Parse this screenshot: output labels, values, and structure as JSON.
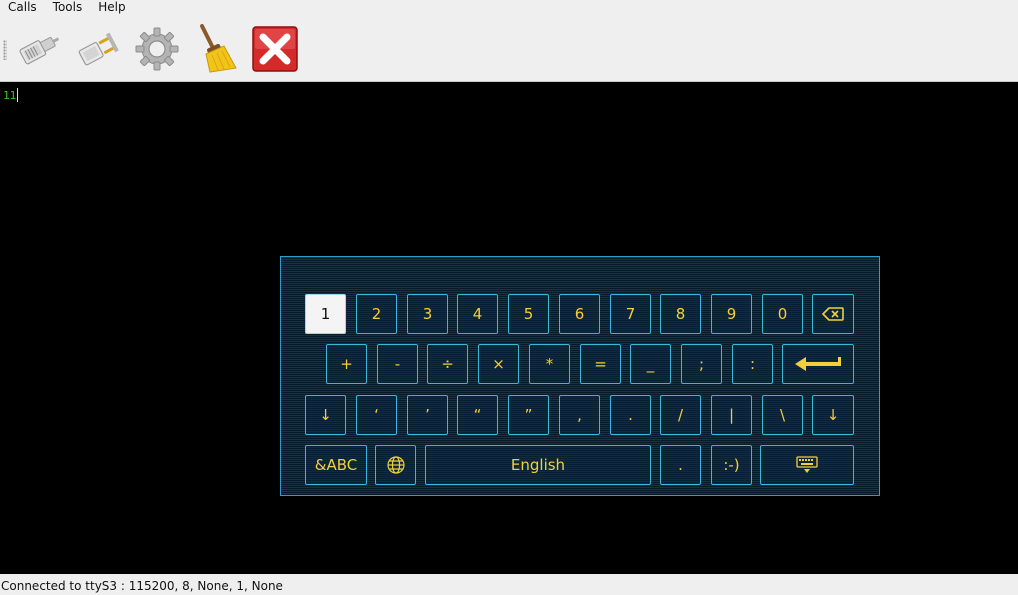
{
  "menubar": {
    "items": [
      "Calls",
      "Tools",
      "Help"
    ]
  },
  "toolbar": {
    "buttons": [
      "connect-icon",
      "disconnect-icon",
      "settings-gear-icon",
      "clear-broom-icon",
      "quit-close-icon"
    ]
  },
  "terminal": {
    "text": "11"
  },
  "keyboard": {
    "row1": [
      "1",
      "2",
      "3",
      "4",
      "5",
      "6",
      "7",
      "8",
      "9",
      "0"
    ],
    "row2": [
      "+",
      "-",
      "÷",
      "×",
      "*",
      "=",
      "_",
      ";",
      ":"
    ],
    "row3": [
      "↓",
      "‘",
      "’",
      "“",
      "”",
      ",",
      ".",
      "/",
      "|",
      "\\",
      "↓"
    ],
    "row4": {
      "mode": "&ABC",
      "space": "English",
      "period": ".",
      "smiley": ":-)"
    },
    "colors": {
      "key_text": "#f4cf3d",
      "key_border": "#39b7dd",
      "active_key_bg": "#f4f4f4"
    }
  },
  "status": {
    "text": "Connected to ttyS3 : 115200, 8, None, 1, None"
  }
}
